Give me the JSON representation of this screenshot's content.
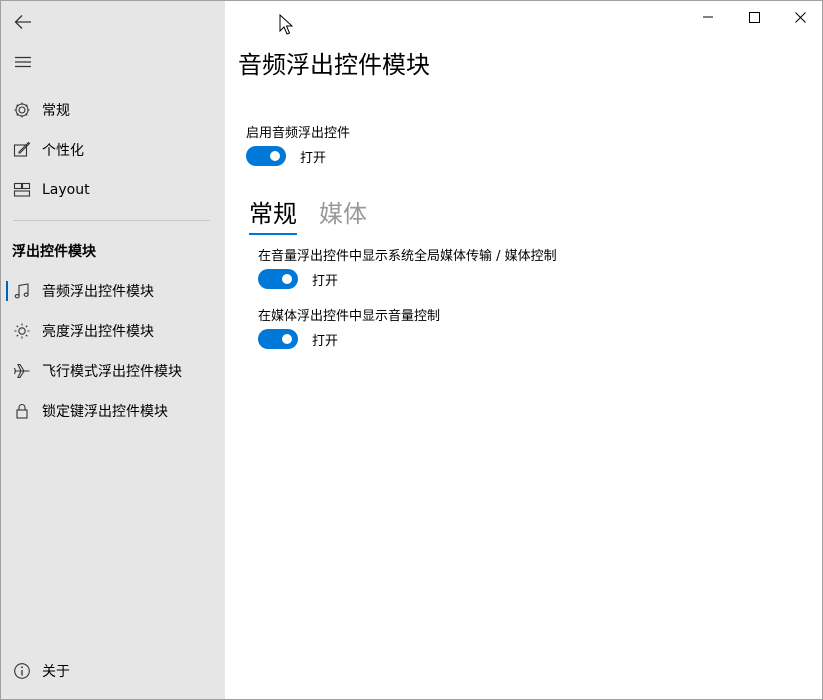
{
  "page": {
    "title": "音频浮出控件模块"
  },
  "sidebar": {
    "items_top": [
      {
        "label": "常规",
        "icon": "gear-icon"
      },
      {
        "label": "个性化",
        "icon": "personalize-icon"
      },
      {
        "label": "Layout",
        "icon": "layout-icon"
      }
    ],
    "section_header": "浮出控件模块",
    "items_modules": [
      {
        "label": "音频浮出控件模块",
        "icon": "music-icon",
        "selected": true
      },
      {
        "label": "亮度浮出控件模块",
        "icon": "brightness-icon"
      },
      {
        "label": "飞行模式浮出控件模块",
        "icon": "airplane-icon"
      },
      {
        "label": "锁定键浮出控件模块",
        "icon": "lock-icon"
      }
    ],
    "about": {
      "label": "关于",
      "icon": "info-icon"
    }
  },
  "main": {
    "enable": {
      "label": "启用音频浮出控件",
      "state": "打开",
      "on": true
    },
    "tabs": [
      {
        "label": "常规",
        "active": true
      },
      {
        "label": "媒体",
        "active": false
      }
    ],
    "settings": [
      {
        "label": "在音量浮出控件中显示系统全局媒体传输 / 媒体控制",
        "state": "打开",
        "on": true
      },
      {
        "label": "在媒体浮出控件中显示音量控制",
        "state": "打开",
        "on": true
      }
    ]
  },
  "colors": {
    "accent": "#0078d7",
    "sidebar_bg": "#e6e6e6"
  }
}
